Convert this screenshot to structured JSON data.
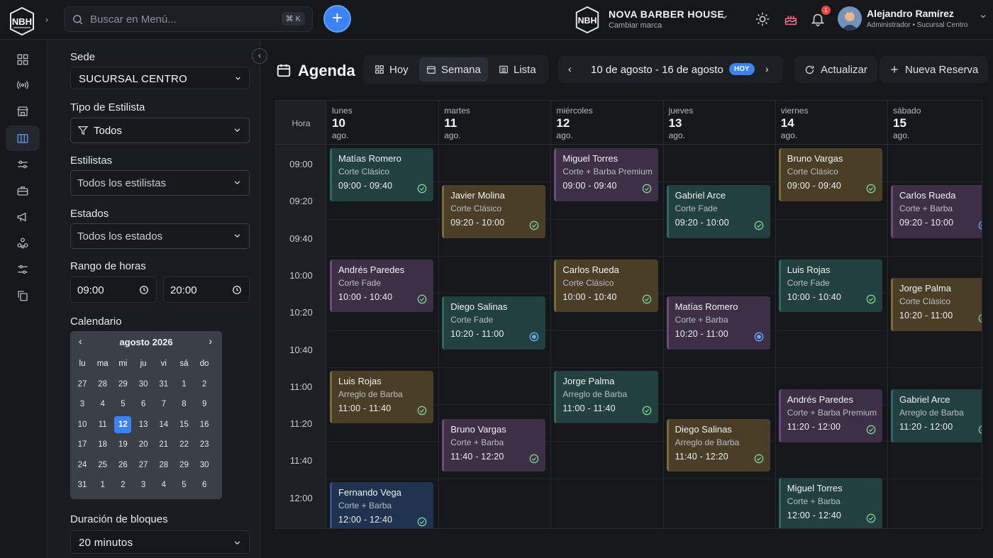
{
  "topbar": {
    "logo_text": "NBH",
    "search_placeholder": "Buscar en Menú...",
    "search_shortcut": "⌘ K",
    "add_label": "+",
    "brand_name": "NOVA BARBER HOUSE",
    "brand_sub": "Cambiar marca",
    "notifications_count": "1",
    "user_name": "Alejandro Ramírez",
    "user_role": "Administrador • Sucursal Centro"
  },
  "rail": {
    "icons": [
      "dashboard-icon",
      "broadcast-icon",
      "store-icon",
      "map-icon",
      "sliders-icon",
      "toolbox-icon",
      "megaphone-icon",
      "network-icon",
      "settings-sliders-icon",
      "copy-icon"
    ],
    "active_index": 3
  },
  "filters": {
    "sede_label": "Sede",
    "sede_value": "SUCURSAL CENTRO",
    "tipo_label": "Tipo de Estilista",
    "tipo_value": "Todos",
    "estilistas_label": "Estilistas",
    "estilistas_value": "Todos los estilistas",
    "estados_label": "Estados",
    "estados_value": "Todos los estados",
    "rango_label": "Rango de horas",
    "hora_inicio": "09:00",
    "hora_fin": "20:00",
    "calendario_label": "Calendario",
    "duracion_label": "Duración de bloques",
    "duracion_value": "20 minutos"
  },
  "mini_calendar": {
    "title": "agosto 2026",
    "prev": "‹",
    "next": "›",
    "weekdays": [
      "lu",
      "ma",
      "mi",
      "ju",
      "vi",
      "sá",
      "do"
    ],
    "weeks": [
      [
        "27",
        "28",
        "29",
        "30",
        "31",
        "1",
        "2"
      ],
      [
        "3",
        "4",
        "5",
        "6",
        "7",
        "8",
        "9"
      ],
      [
        "10",
        "11",
        "12",
        "13",
        "14",
        "15",
        "16"
      ],
      [
        "17",
        "18",
        "19",
        "20",
        "21",
        "22",
        "23"
      ],
      [
        "24",
        "25",
        "26",
        "27",
        "28",
        "29",
        "30"
      ],
      [
        "31",
        "1",
        "2",
        "3",
        "4",
        "5",
        "6"
      ]
    ],
    "selected": "12"
  },
  "header": {
    "title": "Agenda",
    "view_hoy": "Hoy",
    "view_semana": "Semana",
    "view_lista": "Lista",
    "range_text": "10 de agosto - 16 de agosto",
    "hoy_pill": "HOY",
    "refresh_label": "Actualizar",
    "new_label": "Nueva Reserva"
  },
  "schedule": {
    "hora_label": "Hora",
    "days": [
      {
        "name": "lunes",
        "num": "10",
        "month": "ago."
      },
      {
        "name": "martes",
        "num": "11",
        "month": "ago."
      },
      {
        "name": "miércoles",
        "num": "12",
        "month": "ago."
      },
      {
        "name": "jueves",
        "num": "13",
        "month": "ago."
      },
      {
        "name": "viernes",
        "num": "14",
        "month": "ago."
      },
      {
        "name": "sábado",
        "num": "15",
        "month": "ago."
      }
    ],
    "times": [
      "09:00",
      "09:20",
      "09:40",
      "10:00",
      "10:20",
      "10:40",
      "11:00",
      "11:20",
      "11:40",
      "12:00"
    ],
    "events": [
      {
        "day": 0,
        "slot": 0,
        "len": 2,
        "color": "green",
        "name": "Matías Romero",
        "service": "Corte Clásico",
        "time": "09:00 - 09:40",
        "status": "check"
      },
      {
        "day": 0,
        "slot": 3,
        "len": 2,
        "color": "purple",
        "name": "Andrés Paredes",
        "service": "Corte Fade",
        "time": "10:00 - 10:40",
        "status": "check"
      },
      {
        "day": 0,
        "slot": 6,
        "len": 2,
        "color": "brown",
        "name": "Luis Rojas",
        "service": "Arreglo de Barba",
        "time": "11:00 - 11:40",
        "status": "check"
      },
      {
        "day": 0,
        "slot": 9,
        "len": 2,
        "color": "blue",
        "name": "Fernando Vega",
        "service": "Corte + Barba",
        "time": "12:00 - 12:40",
        "status": "check"
      },
      {
        "day": 1,
        "slot": 1,
        "len": 2,
        "color": "brown",
        "name": "Javier Molina",
        "service": "Corte Clásico",
        "time": "09:20 - 10:00",
        "status": "check"
      },
      {
        "day": 1,
        "slot": 4,
        "len": 2,
        "color": "green",
        "name": "Diego Salinas",
        "service": "Corte Fade",
        "time": "10:20 - 11:00",
        "status": "pending"
      },
      {
        "day": 1,
        "slot": 7.3,
        "len": 2,
        "color": "purple",
        "name": "Bruno Vargas",
        "service": "Corte + Barba",
        "time": "11:40 - 12:20",
        "status": "check"
      },
      {
        "day": 2,
        "slot": 0,
        "len": 2,
        "color": "purple",
        "name": "Miguel Torres",
        "service": "Corte + Barba Premium",
        "time": "09:00 - 09:40",
        "status": "check"
      },
      {
        "day": 2,
        "slot": 3,
        "len": 2,
        "color": "brown",
        "name": "Carlos Rueda",
        "service": "Corte Clásico",
        "time": "10:00 - 10:40",
        "status": "check"
      },
      {
        "day": 2,
        "slot": 6,
        "len": 2,
        "color": "green",
        "name": "Jorge Palma",
        "service": "Arreglo de Barba",
        "time": "11:00 - 11:40",
        "status": "check"
      },
      {
        "day": 3,
        "slot": 1,
        "len": 2,
        "color": "green",
        "name": "Gabriel Arce",
        "service": "Corte Fade",
        "time": "09:20 - 10:00",
        "status": "check"
      },
      {
        "day": 3,
        "slot": 4,
        "len": 2,
        "color": "purple",
        "name": "Matías Romero",
        "service": "Corte + Barba",
        "time": "10:20 - 11:00",
        "status": "pending"
      },
      {
        "day": 3,
        "slot": 7.3,
        "len": 2,
        "color": "brown",
        "name": "Diego Salinas",
        "service": "Arreglo de Barba",
        "time": "11:40 - 12:20",
        "status": "check"
      },
      {
        "day": 4,
        "slot": 0,
        "len": 2,
        "color": "brown",
        "name": "Bruno Vargas",
        "service": "Corte Clásico",
        "time": "09:00 - 09:40",
        "status": "check"
      },
      {
        "day": 4,
        "slot": 3,
        "len": 2,
        "color": "green",
        "name": "Luis Rojas",
        "service": "Corte Fade",
        "time": "10:00 - 10:40",
        "status": "check"
      },
      {
        "day": 4,
        "slot": 6.5,
        "len": 2,
        "color": "purple",
        "name": "Andrés Paredes",
        "service": "Corte + Barba Premium",
        "time": "11:20 - 12:00",
        "status": "check"
      },
      {
        "day": 4,
        "slot": 8.9,
        "len": 2,
        "color": "green",
        "name": "Miguel Torres",
        "service": "Corte + Barba",
        "time": "12:00 - 12:40",
        "status": "check"
      },
      {
        "day": 5,
        "slot": 1,
        "len": 2,
        "color": "purple",
        "name": "Carlos Rueda",
        "service": "Corte + Barba",
        "time": "09:20 - 10:00",
        "status": "pending"
      },
      {
        "day": 5,
        "slot": 3.5,
        "len": 2,
        "color": "brown",
        "name": "Jorge Palma",
        "service": "Corte Clásico",
        "time": "10:20 - 11:00",
        "status": "check"
      },
      {
        "day": 5,
        "slot": 6.5,
        "len": 2,
        "color": "green",
        "name": "Gabriel Arce",
        "service": "Arreglo de Barba",
        "time": "11:20 - 12:00",
        "status": "check"
      }
    ]
  }
}
